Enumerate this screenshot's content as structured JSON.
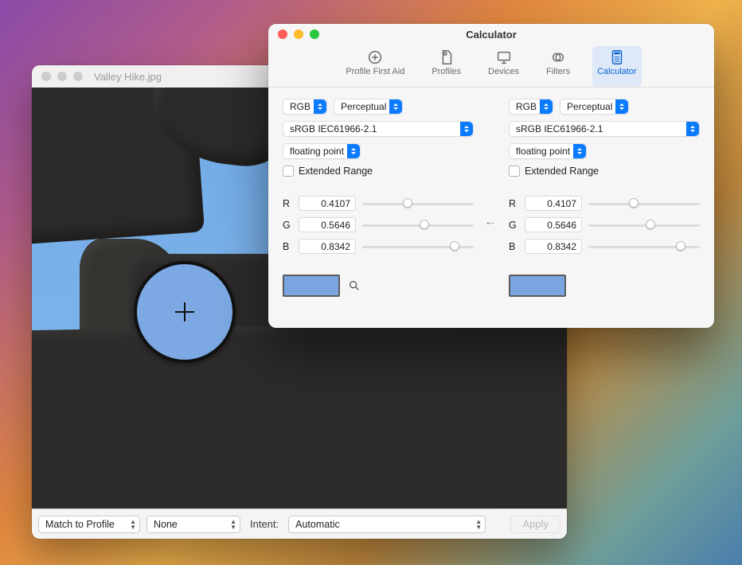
{
  "image_window": {
    "title": "Valley Hike.jpg",
    "footer": {
      "action_select": "Match to Profile",
      "profile_select": "None",
      "intent_label": "Intent:",
      "intent_select": "Automatic",
      "apply_label": "Apply"
    }
  },
  "calc_window": {
    "title": "Calculator",
    "toolbar": {
      "items": [
        {
          "id": "profile-first-aid",
          "label": "Profile First Aid"
        },
        {
          "id": "profiles",
          "label": "Profiles"
        },
        {
          "id": "devices",
          "label": "Devices"
        },
        {
          "id": "filters",
          "label": "Filters"
        },
        {
          "id": "calculator",
          "label": "Calculator",
          "selected": true
        }
      ]
    },
    "left": {
      "model": "RGB",
      "intent": "Perceptual",
      "profile": "sRGB IEC61966-2.1",
      "numtype": "floating point",
      "extended_label": "Extended Range",
      "channels": [
        {
          "label": "R",
          "value": "0.4107"
        },
        {
          "label": "G",
          "value": "0.5646"
        },
        {
          "label": "B",
          "value": "0.8342"
        }
      ],
      "swatch": "#79a5e0"
    },
    "right": {
      "model": "RGB",
      "intent": "Perceptual",
      "profile": "sRGB IEC61966-2.1",
      "numtype": "floating point",
      "extended_label": "Extended Range",
      "channels": [
        {
          "label": "R",
          "value": "0.4107"
        },
        {
          "label": "G",
          "value": "0.5646"
        },
        {
          "label": "B",
          "value": "0.8342"
        }
      ],
      "swatch": "#79a5e0"
    },
    "arrow": "←"
  }
}
